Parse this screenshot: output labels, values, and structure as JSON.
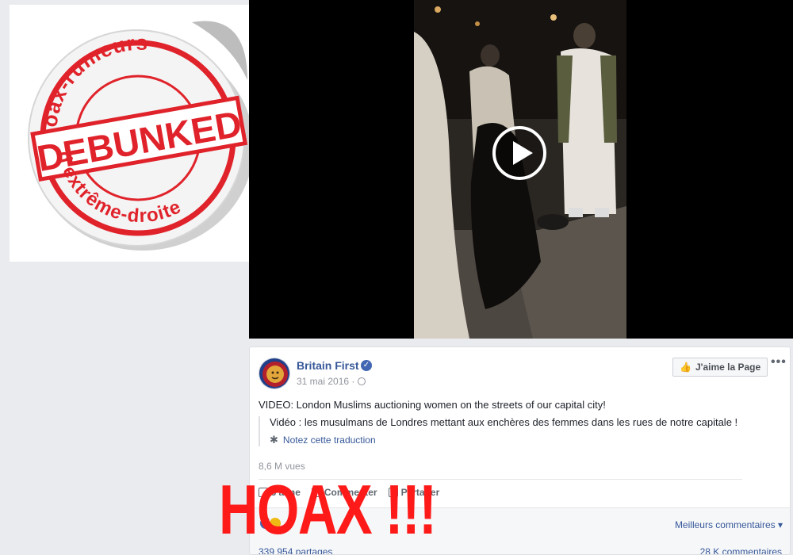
{
  "sticker": {
    "top_text": "Hoax-rumeurs",
    "middle_text": "DEBUNKED",
    "bottom_text": "d'extrême-droite",
    "color": "#e0232b"
  },
  "video": {
    "play_icon": "play-icon"
  },
  "post": {
    "page_name": "Britain First",
    "verified_icon": "verified-badge-icon",
    "date": "31 mai 2016 ·",
    "like_page_label": "J'aime la Page",
    "more_label": "•••",
    "text": "VIDEO: London Muslims auctioning women on the streets of our capital city!",
    "translation": "Vidéo : les musulmans de Londres mettant aux enchères des femmes dans les rues de notre capitale !",
    "rate_translation": "Notez cette traduction",
    "views": "8,6 M vues",
    "actions": {
      "like": "J'aime",
      "comment": "Commenter",
      "share": "Partager"
    },
    "best_comments": "Meilleurs commentaires ▾",
    "shares": "339 954 partages",
    "comments_count": "28 K commentaires"
  },
  "overlay": {
    "hoax_text": "HOAX !!!",
    "color": "#ff1a1a"
  }
}
